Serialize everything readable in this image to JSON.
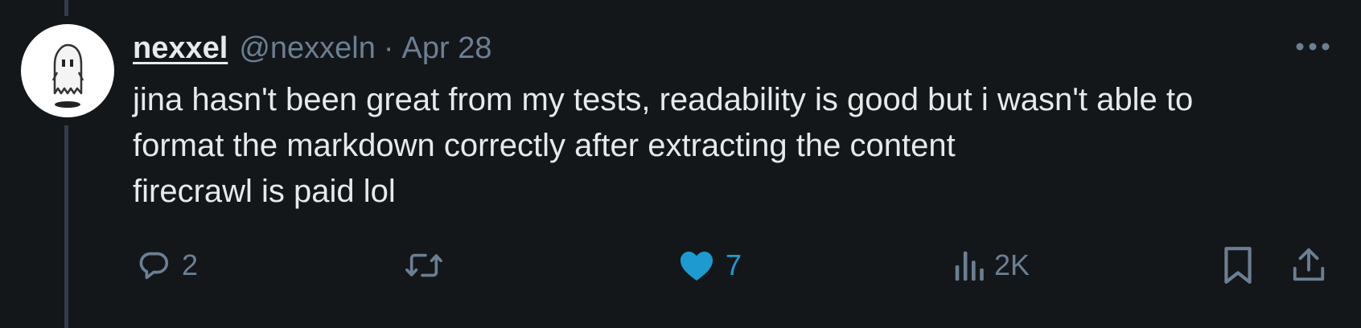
{
  "tweet": {
    "author": {
      "display_name": "nexxel",
      "handle": "@nexxeln",
      "avatar_icon": "ghost-avatar"
    },
    "separator": "·",
    "date": "Apr 28",
    "text_lines": [
      "jina hasn't been great from my tests, readability is good but i wasn't able to",
      "format the markdown correctly after extracting the content",
      "firecrawl is paid lol"
    ],
    "actions": {
      "reply": {
        "icon": "reply-icon",
        "count": "2"
      },
      "retweet": {
        "icon": "retweet-icon",
        "count": ""
      },
      "like": {
        "icon": "heart-icon",
        "count": "7",
        "liked": true
      },
      "views": {
        "icon": "views-icon",
        "count": "2K"
      },
      "bookmark": {
        "icon": "bookmark-icon"
      },
      "share": {
        "icon": "share-icon"
      }
    },
    "more_icon": "more-icon"
  },
  "colors": {
    "background": "#14171a",
    "text_primary": "#e7e9ea",
    "text_secondary": "#6b7f92",
    "like_accent": "#1d9bd1",
    "thread_line": "#333c48"
  }
}
